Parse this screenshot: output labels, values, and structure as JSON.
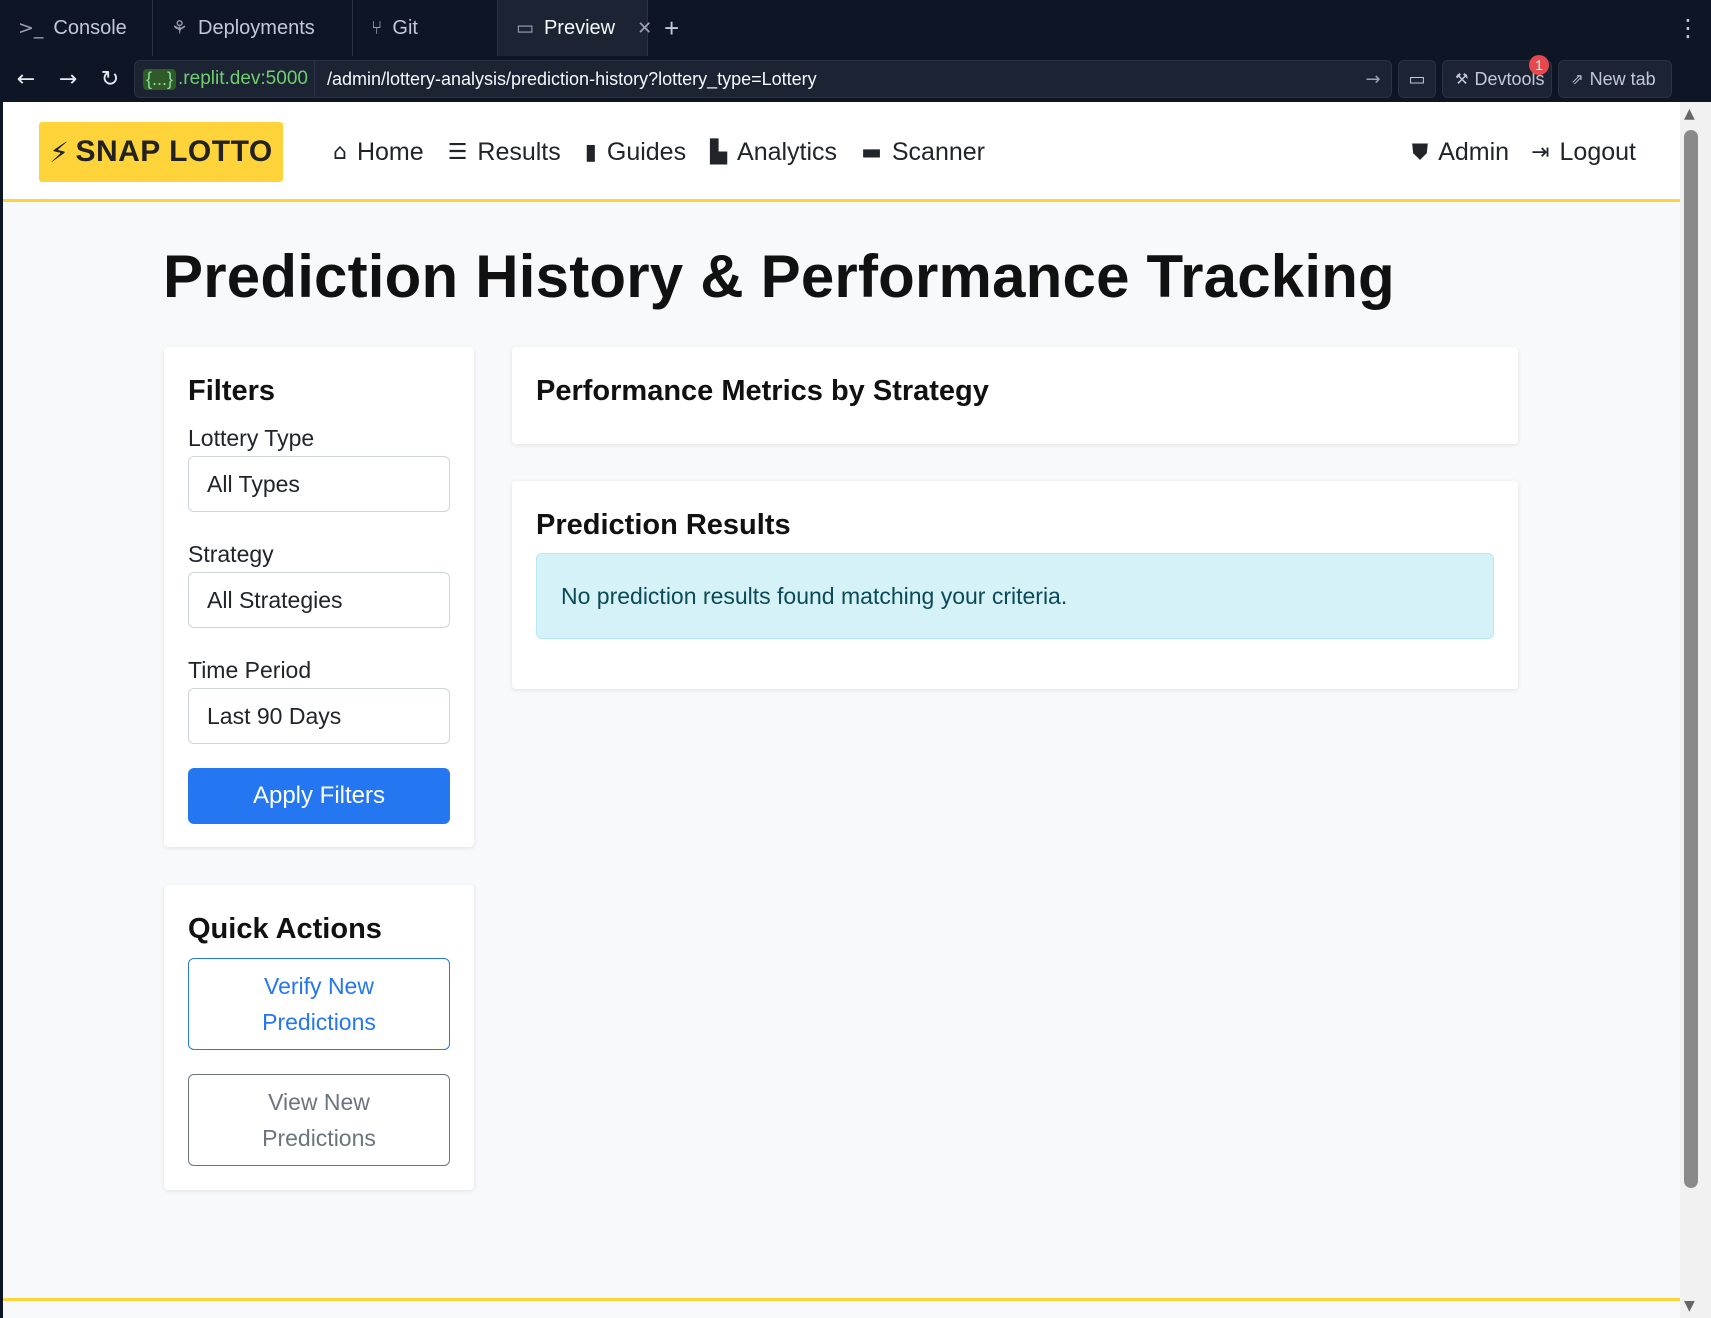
{
  "browser": {
    "tabs": [
      {
        "label": "Console",
        "icon": "terminal-icon",
        "glyph": ">_"
      },
      {
        "label": "Deployments",
        "icon": "deploy-icon",
        "glyph": "⚘"
      },
      {
        "label": "Git",
        "icon": "git-icon",
        "glyph": "⑂"
      },
      {
        "label": "Preview",
        "icon": "monitor-icon",
        "glyph": "▭",
        "active": true
      }
    ],
    "new_tab_glyph": "+",
    "url_braces": "{...}",
    "url_host": ".replit.dev:5000",
    "url_path": "/admin/lottery-analysis/prediction-history?lottery_type=Lottery",
    "devtools_label": "Devtools",
    "devtools_badge": "1",
    "new_tab_label": "New tab"
  },
  "site": {
    "brand": "SNAP LOTTO",
    "nav": [
      {
        "label": "Home",
        "icon": "home-icon",
        "glyph": "⌂"
      },
      {
        "label": "Results",
        "icon": "list-icon",
        "glyph": "☰"
      },
      {
        "label": "Guides",
        "icon": "book-icon",
        "glyph": "▮"
      },
      {
        "label": "Analytics",
        "icon": "chart-icon",
        "glyph": "▙"
      },
      {
        "label": "Scanner",
        "icon": "ticket-icon",
        "glyph": "▬"
      }
    ],
    "nav_right": [
      {
        "label": "Admin",
        "icon": "shield-icon",
        "glyph": "⛊"
      },
      {
        "label": "Logout",
        "icon": "logout-icon",
        "glyph": "⇥"
      }
    ],
    "accent": "#ffd43b",
    "primary": "#2477f0"
  },
  "page": {
    "title": "Prediction History & Performance Tracking"
  },
  "filters": {
    "heading": "Filters",
    "lottery_type_label": "Lottery Type",
    "lottery_type_value": "All Types",
    "strategy_label": "Strategy",
    "strategy_value": "All Strategies",
    "time_period_label": "Time Period",
    "time_period_value": "Last 90 Days",
    "apply_label": "Apply Filters"
  },
  "quick_actions": {
    "heading": "Quick Actions",
    "verify_label": "Verify New Predictions",
    "view_label": "View New Predictions"
  },
  "metrics": {
    "heading": "Performance Metrics by Strategy"
  },
  "results": {
    "heading": "Prediction Results",
    "empty_message": "No prediction results found matching your criteria."
  }
}
